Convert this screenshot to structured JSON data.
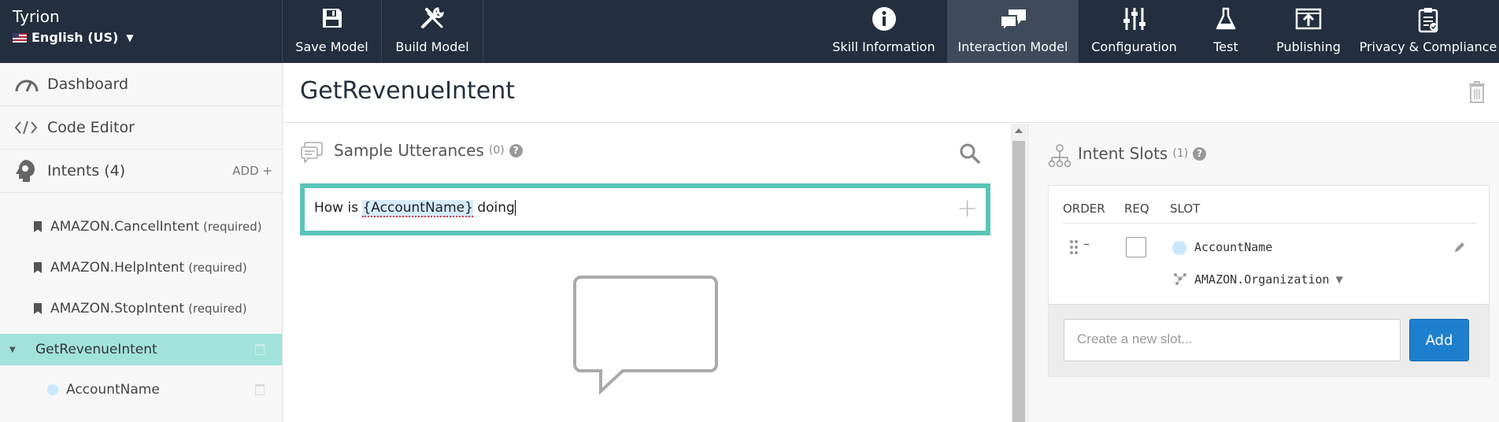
{
  "app": {
    "skill_name": "Tyrion",
    "locale": "English (US)",
    "locale_caret": "▼"
  },
  "toolbar": {
    "save_label": "Save Model",
    "build_label": "Build Model"
  },
  "nav": {
    "skill_info": "Skill Information",
    "interaction_model": "Interaction Model",
    "configuration": "Configuration",
    "test": "Test",
    "publishing": "Publishing",
    "privacy": "Privacy & Compliance",
    "active": "Interaction Model"
  },
  "sidebar": {
    "dashboard": "Dashboard",
    "code_editor": "Code Editor",
    "intents_label": "Intents (4)",
    "add_label": "ADD +",
    "intents": [
      {
        "name": "AMAZON.CancelIntent",
        "note": "(required)"
      },
      {
        "name": "AMAZON.HelpIntent",
        "note": "(required)"
      },
      {
        "name": "AMAZON.StopIntent",
        "note": "(required)"
      },
      {
        "name": "GetRevenueIntent",
        "note": ""
      }
    ],
    "selected_slot": "AccountName"
  },
  "main": {
    "title": "GetRevenueIntent"
  },
  "utterances": {
    "title": "Sample Utterances",
    "count": "(0)",
    "help": "?",
    "input_prefix": "How is ",
    "input_slot": "{AccountName}",
    "input_suffix": " doing",
    "add_symbol": "+"
  },
  "slots": {
    "title": "Intent Slots",
    "count": "(1)",
    "help": "?",
    "col_order": "ORDER",
    "col_req": "REQ",
    "col_slot": "SLOT",
    "rows": [
      {
        "name": "AccountName",
        "type": "AMAZON.Organization",
        "type_caret": "▼",
        "order_symbol": "–",
        "required": false
      }
    ],
    "new_slot_placeholder": "Create a new slot...",
    "add_button": "Add"
  },
  "colors": {
    "topbar": "#232f3e",
    "active_tab": "#3f4b5b",
    "selected_intent": "#a1e3da",
    "utterance_border": "#59c4b8",
    "add_button": "#1f7fcf",
    "slot_dot": "#c7e9fb"
  },
  "icons": {
    "save": "floppy-disk-icon",
    "build": "hammer-wrench-icon",
    "skill_info": "info-circle-icon",
    "interaction": "chat-bubbles-icon",
    "configuration": "sliders-icon",
    "test": "flask-icon",
    "publishing": "upload-icon",
    "privacy": "clipboard-check-icon"
  }
}
